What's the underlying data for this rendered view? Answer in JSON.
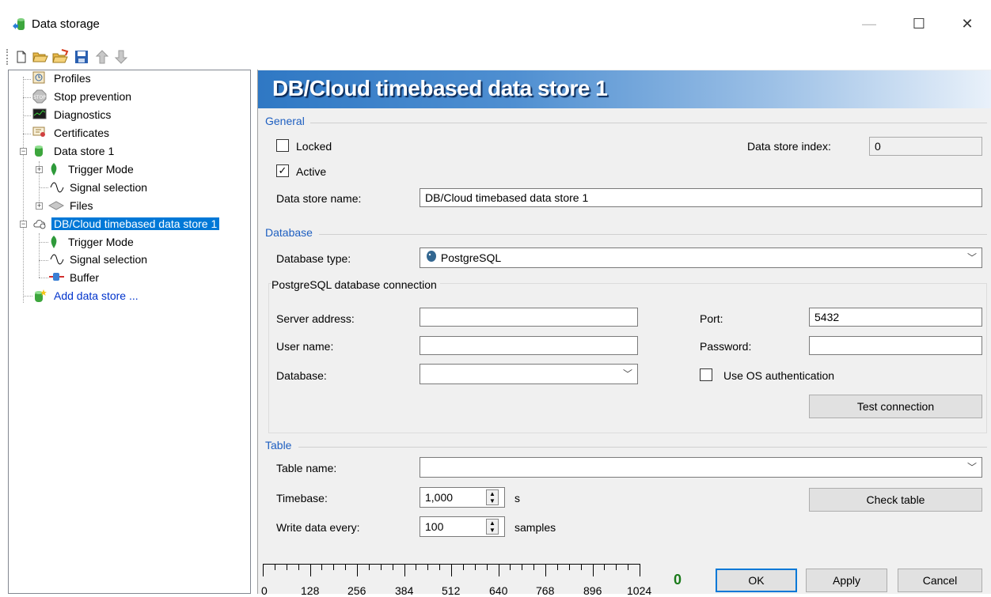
{
  "window": {
    "title": "Data storage",
    "controls": {
      "minimize": "—",
      "maximize": "☐",
      "close": "✕"
    }
  },
  "toolbar": {
    "buttons": [
      {
        "name": "new-icon"
      },
      {
        "name": "open-icon"
      },
      {
        "name": "open-folder-icon"
      },
      {
        "name": "save-icon"
      },
      {
        "name": "move-up-icon"
      },
      {
        "name": "move-down-icon"
      }
    ]
  },
  "tree": {
    "items": [
      {
        "label": "Profiles",
        "icon": "profiles-icon"
      },
      {
        "label": "Stop prevention",
        "icon": "stop-icon"
      },
      {
        "label": "Diagnostics",
        "icon": "diagnostics-icon"
      },
      {
        "label": "Certificates",
        "icon": "certificate-icon"
      },
      {
        "label": "Data store 1",
        "icon": "data-store-icon"
      },
      {
        "label": "Trigger Mode",
        "icon": "trigger-icon"
      },
      {
        "label": "Signal selection",
        "icon": "signal-icon"
      },
      {
        "label": "Files",
        "icon": "files-icon"
      },
      {
        "label": "DB/Cloud timebased data store 1",
        "icon": "cloud-store-icon"
      },
      {
        "label": "Trigger Mode",
        "icon": "trigger-icon"
      },
      {
        "label": "Signal selection",
        "icon": "signal-icon"
      },
      {
        "label": "Buffer",
        "icon": "buffer-icon"
      },
      {
        "label": "Add data store ...",
        "icon": "add-store-icon"
      }
    ]
  },
  "header": {
    "title": "DB/Cloud timebased data store 1"
  },
  "general": {
    "section": "General",
    "locked_label": "Locked",
    "locked": false,
    "active_label": "Active",
    "active": true,
    "index_label": "Data store index:",
    "index_value": "0",
    "name_label": "Data store name:",
    "name_value": "DB/Cloud timebased data store 1"
  },
  "database": {
    "section": "Database",
    "type_label": "Database type:",
    "type_value": "PostgreSQL",
    "connection_group": "PostgreSQL database connection",
    "server_label": "Server address:",
    "server_value": "",
    "port_label": "Port:",
    "port_value": "5432",
    "user_label": "User name:",
    "user_value": "",
    "password_label": "Password:",
    "password_value": "",
    "database_label": "Database:",
    "database_value": "",
    "os_auth_label": "Use OS authentication",
    "os_auth": false,
    "test_button": "Test connection"
  },
  "table": {
    "section": "Table",
    "name_label": "Table name:",
    "name_value": "",
    "timebase_label": "Timebase:",
    "timebase_value": "1,000",
    "timebase_unit": "s",
    "write_label": "Write data every:",
    "write_value": "100",
    "write_unit": "samples",
    "check_button": "Check table"
  },
  "footer": {
    "ruler_labels": [
      "0",
      "128",
      "256",
      "384",
      "512",
      "640",
      "768",
      "896",
      "1024"
    ],
    "counter": "0",
    "ok": "OK",
    "apply": "Apply",
    "cancel": "Cancel"
  },
  "colors": {
    "selection": "#0078d7",
    "section_title": "#1e5fc1",
    "counter": "#1a7a1a",
    "link": "#0033cc"
  }
}
